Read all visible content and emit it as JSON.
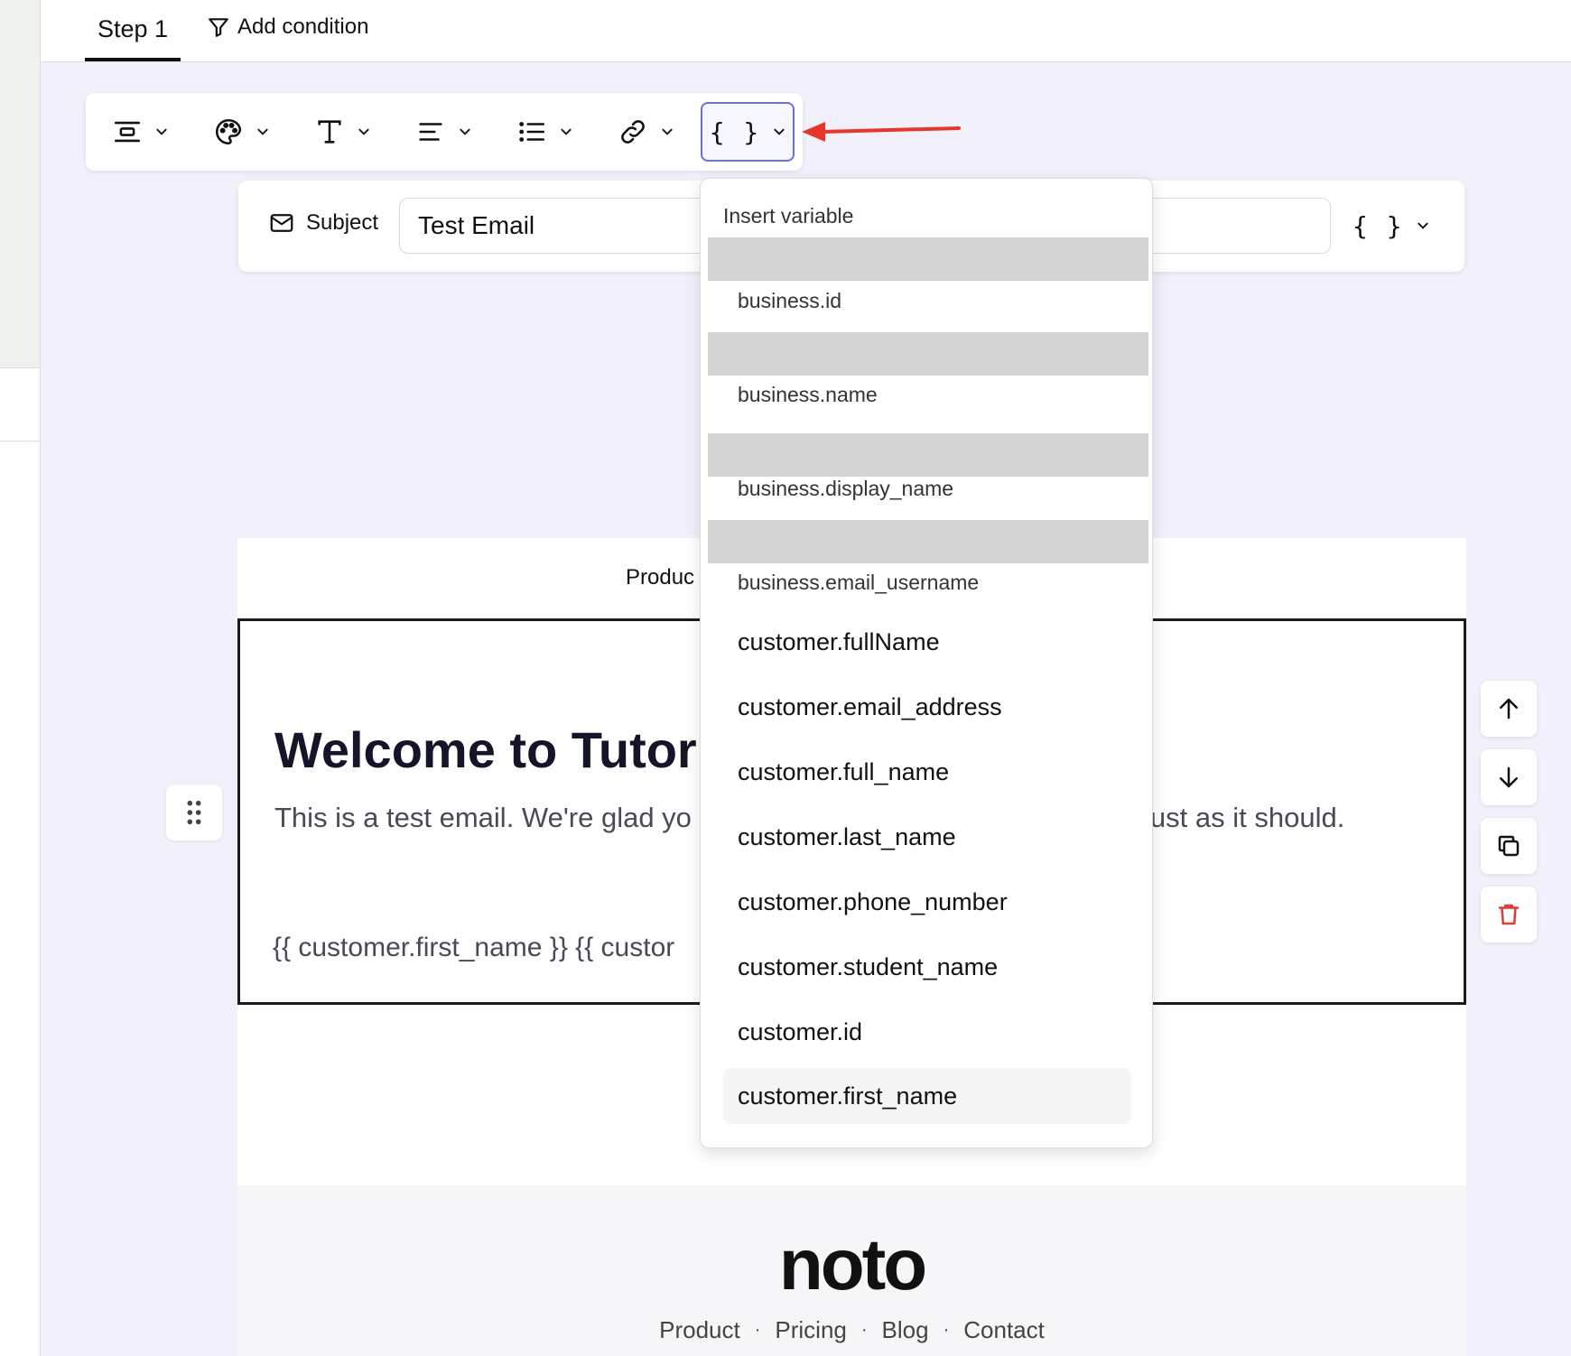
{
  "tabs": {
    "step_label": "Step 1",
    "add_condition_label": "Add condition"
  },
  "toolbar": {
    "variable_button_label": "{ }"
  },
  "subject": {
    "label": "Subject",
    "value": "Test Email",
    "variable_button_label": "{ }"
  },
  "email": {
    "header_nav_partial": "Produc",
    "heading_partial": "Welcome to Tutor",
    "intro_left": "This is a test email. We're glad yo",
    "intro_right": "ust as it should.",
    "variables_line_partial": "{{ customer.first_name }} {{ custor",
    "logo": "noto",
    "footer_links": [
      "Product",
      "Pricing",
      "Blog",
      "Contact"
    ]
  },
  "dropdown": {
    "header": "Insert variable",
    "items": [
      "business.id",
      "business.name",
      "business.display_name",
      "business.email_username",
      "customer.fullName",
      "customer.email_address",
      "customer.full_name",
      "customer.last_name",
      "customer.phone_number",
      "customer.student_name",
      "customer.id",
      "customer.first_name"
    ]
  },
  "colors": {
    "accent": "#6b6ee8",
    "arrow": "#e8352a",
    "delete": "#e03a3a",
    "canvas_bg": "#f1f0fb"
  }
}
